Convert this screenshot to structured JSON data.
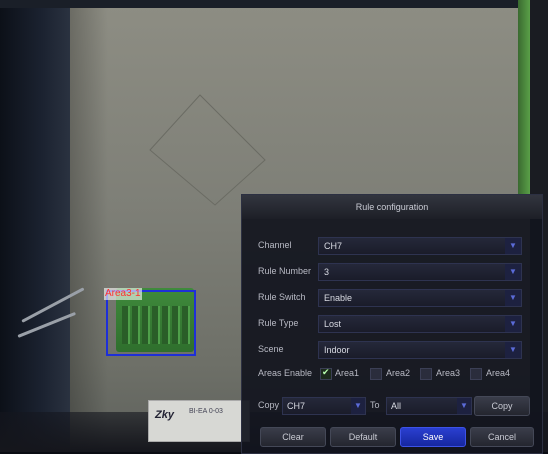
{
  "overlay": {
    "area_label": "Area3-1"
  },
  "sticker": {
    "logo": "Zky",
    "text": "BI-EA 0-03"
  },
  "dialog": {
    "title": "Rule configuration",
    "channel": {
      "label": "Channel",
      "value": "CH7"
    },
    "rule_number": {
      "label": "Rule Number",
      "value": "3"
    },
    "rule_switch": {
      "label": "Rule Switch",
      "value": "Enable"
    },
    "rule_type": {
      "label": "Rule Type",
      "value": "Lost"
    },
    "scene": {
      "label": "Scene",
      "value": "Indoor"
    },
    "areas_enable": {
      "label": "Areas Enable",
      "areas": [
        {
          "label": "Area1",
          "checked": true
        },
        {
          "label": "Area2",
          "checked": false
        },
        {
          "label": "Area3",
          "checked": false
        },
        {
          "label": "Area4",
          "checked": false
        }
      ]
    },
    "copy": {
      "label": "Copy",
      "from": "CH7",
      "to_label": "To",
      "to": "All",
      "button": "Copy"
    },
    "buttons": {
      "clear": "Clear",
      "default": "Default",
      "save": "Save",
      "cancel": "Cancel"
    },
    "colors": {
      "accent": "#1e2fd8",
      "save_button": "#2a3fd0"
    }
  }
}
